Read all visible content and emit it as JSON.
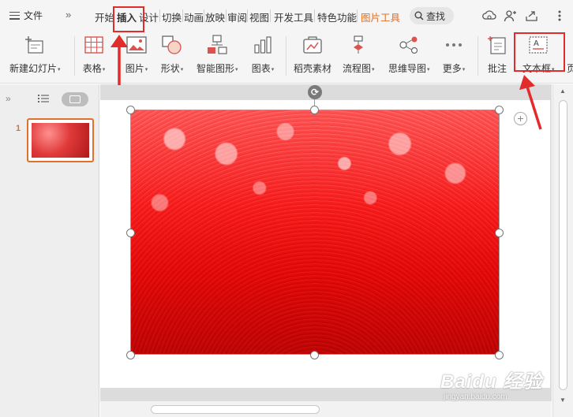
{
  "menu": {
    "label": "文件"
  },
  "tabs": [
    {
      "label": "开始"
    },
    {
      "label": "插入"
    },
    {
      "label": "设计"
    },
    {
      "label": "切换"
    },
    {
      "label": "动画"
    },
    {
      "label": "放映"
    },
    {
      "label": "审阅"
    },
    {
      "label": "视图"
    },
    {
      "label": "开发工具"
    },
    {
      "label": "特色功能"
    },
    {
      "label": "图片工具"
    }
  ],
  "search": {
    "label": "查找"
  },
  "ribbon": {
    "new_slide": "新建幻灯片",
    "table": "表格",
    "picture": "图片",
    "shape": "形状",
    "smart_art": "智能图形",
    "chart": "图表",
    "stock_material": "稻壳素材",
    "flowchart": "流程图",
    "mindmap": "思维导图",
    "more": "更多",
    "comment": "批注",
    "textbox": "文本框",
    "cut_off": "页"
  },
  "slides_pane": {
    "slide_number": "1"
  },
  "colors": {
    "accent": "#e0702a",
    "annotation": "#e22b2b"
  },
  "watermark": {
    "main": "Baidu 经验",
    "sub": "jingyan.baidu.com"
  }
}
